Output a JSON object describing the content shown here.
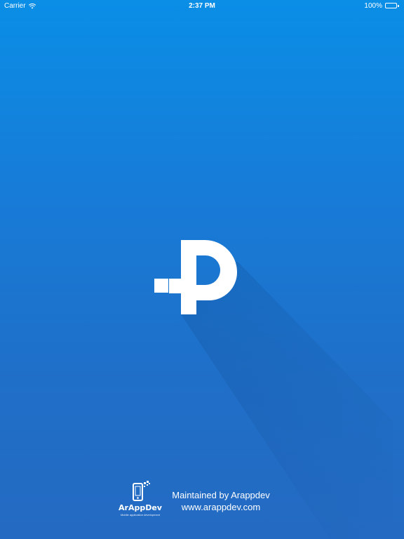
{
  "status_bar": {
    "carrier": "Carrier",
    "time": "2:37 PM",
    "battery": "100%",
    "wifi_icon": "wifi-icon",
    "battery_icon": "battery-icon"
  },
  "splash": {
    "logo_icon": "p-logo-icon",
    "background_color_top": "#0a8ee6",
    "background_color_bottom": "#246ac2"
  },
  "footer": {
    "brand_name": "ArAppDev",
    "brand_tagline": "Mobile application development",
    "maintained_by": "Maintained by Arappdev",
    "website": "www.arappdev.com"
  }
}
